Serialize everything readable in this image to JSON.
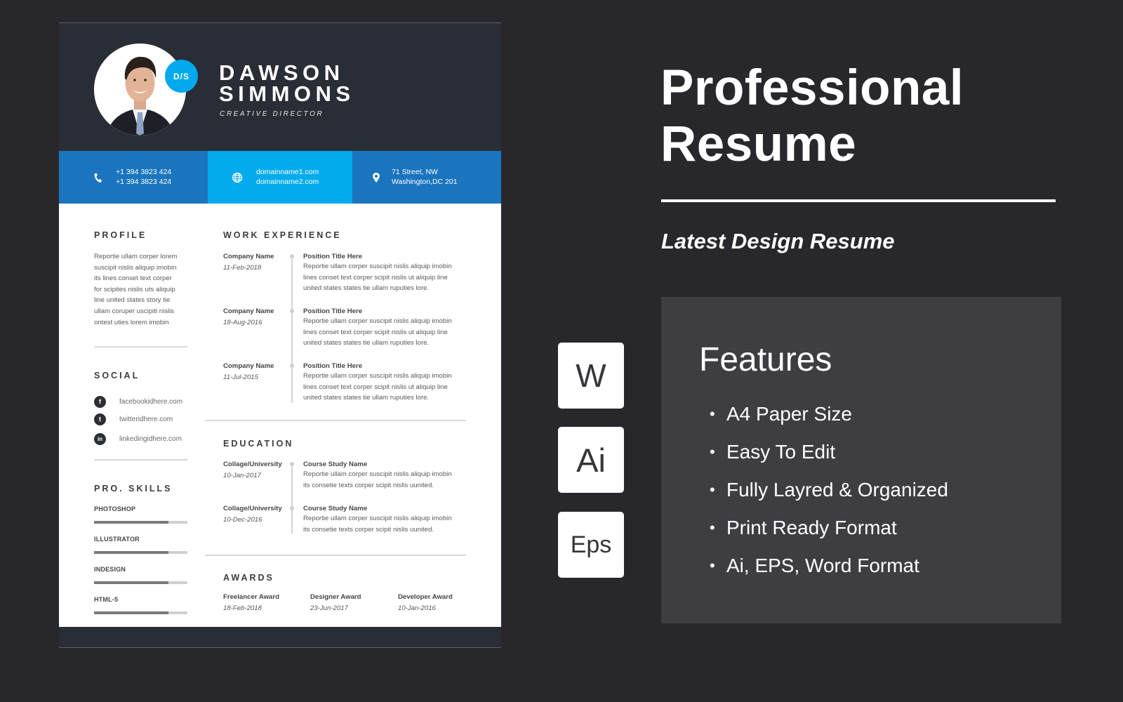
{
  "resume": {
    "monogram": "D/S",
    "first_name": "DAWSON",
    "last_name": "SIMMONS",
    "job_title": "CREATIVE DIRECTOR",
    "contact": {
      "phone": {
        "icon": "phone-icon",
        "lines": [
          "+1 394 3823 424",
          "+1 394 3823 424"
        ]
      },
      "web": {
        "icon": "globe-icon",
        "lines": [
          "domainname1.com",
          "domainname2.com"
        ]
      },
      "address": {
        "icon": "location-pin-icon",
        "lines": [
          "71 Street, NW",
          "Washington,DC 201"
        ]
      }
    },
    "colors": {
      "header_bg": "#292d35",
      "contact_dark": "#1b75be",
      "contact_light": "#02abec",
      "accent": "#02a9ec"
    },
    "profile": {
      "title": "PROFILE",
      "lines": [
        "Reportie ullam corper lorem",
        "suscipit nislis aliquip imobin",
        "its lines conset text corper",
        "for scipites nislis uts aliquip",
        "line united states story tie",
        "ullam coruper uscipiti nislis",
        "ontest uties lorem imobin"
      ]
    },
    "social": {
      "title": "SOCIAL",
      "items": [
        {
          "icon": "facebook-icon",
          "glyph": "f",
          "label": "facebookidhere.com"
        },
        {
          "icon": "twitter-icon",
          "glyph": "t",
          "label": "twitteridhere.com"
        },
        {
          "icon": "linkedin-icon",
          "glyph": "in",
          "label": "linkedingidhere.com"
        }
      ]
    },
    "skills": {
      "title": "PRO. SKILLS",
      "items": [
        {
          "name": "PHOTOSHOP",
          "level_percent": 80
        },
        {
          "name": "ILLUSTRATOR",
          "level_percent": 80
        },
        {
          "name": "INDESIGN",
          "level_percent": 80
        },
        {
          "name": "HTML-5",
          "level_percent": 80
        }
      ]
    },
    "work": {
      "title": "WORK EXPERIENCE",
      "items": [
        {
          "company": "Company Name",
          "date": "11-Feb-2018",
          "position": "Position Title Here",
          "lines": [
            "Reportie ullam corper suscipit nislis aliquip imobin",
            "lines conset text corper scipit nislis ut aliquip line",
            "united states states tie ullam ruputies lore."
          ]
        },
        {
          "company": "Company Name",
          "date": "18-Aug-2016",
          "position": "Position Title Here",
          "lines": [
            "Reportie ullam corper suscipit nislis aliquip imobin",
            "lines conset text corper scipit nislis ut aliquip line",
            "united states states tie ullam ruputies lore."
          ]
        },
        {
          "company": "Company Name",
          "date": "11-Jul-2015",
          "position": "Position Title Here",
          "lines": [
            "Reportie ullam corper suscipit nislis aliquip imobin",
            "lines conset text corper scipit nislis ut aliquip line",
            "united states states tie ullam ruputies lore."
          ]
        }
      ]
    },
    "education": {
      "title": "EDUCATION",
      "items": [
        {
          "school": "Collage/University",
          "date": "10-Jan-2017",
          "course": "Course Study Name",
          "lines": [
            "Reportie ullam corper suscipit nislis aliquip imobin",
            "its consetie texts corper scipit nislis uunited."
          ]
        },
        {
          "school": "Collage/University",
          "date": "10-Dec-2016",
          "course": "Course Study Name",
          "lines": [
            "Reportie ullam corper suscipit nislis aliquip imobin",
            "its consetie texts corper scipit nislis uunited."
          ]
        }
      ]
    },
    "awards": {
      "title": "AWARDS",
      "items": [
        {
          "name": "Freelancer Award",
          "date": "18-Feb-2018"
        },
        {
          "name": "Designer Award",
          "date": "23-Jun-2017"
        },
        {
          "name": "Developer Award",
          "date": "10-Jan-2016"
        }
      ]
    }
  },
  "promo": {
    "title_line1": "Professional",
    "title_line2": "Resume",
    "subtitle": "Latest Design Resume",
    "formats": [
      {
        "icon": "word-format-icon",
        "label": "W"
      },
      {
        "icon": "illustrator-format-icon",
        "label": "Ai"
      },
      {
        "icon": "eps-format-icon",
        "label": "Eps"
      }
    ],
    "features_title": "Features",
    "features": [
      "A4  Paper Size",
      "Easy To Edit",
      "Fully Layred & Organized",
      "Print Ready Format",
      "Ai, EPS, Word Format"
    ],
    "colors": {
      "page_bg": "#28272c",
      "panel_bg": "#3e3d42",
      "text": "#ffffff"
    }
  }
}
